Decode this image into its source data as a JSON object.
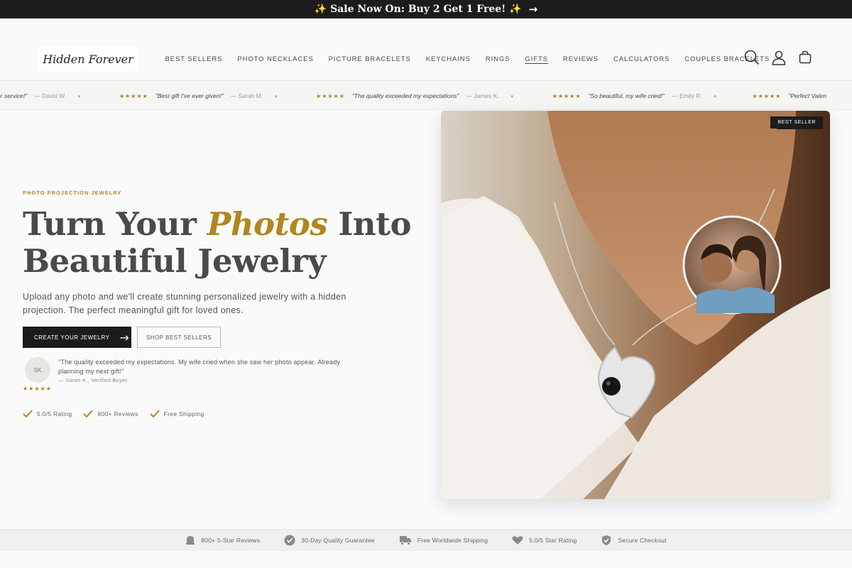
{
  "announcement": {
    "text": "✨ Sale Now On: Buy 2 Get 1 Free! ✨",
    "arrow": "→"
  },
  "logo": {
    "text": "Hidden Forever"
  },
  "nav": [
    {
      "label": "BEST SELLERS"
    },
    {
      "label": "PHOTO NECKLACES"
    },
    {
      "label": "PICTURE BRACELETS"
    },
    {
      "label": "KEYCHAINS"
    },
    {
      "label": "RINGS"
    },
    {
      "label": "GIFTS",
      "active": true
    },
    {
      "label": "REVIEWS"
    },
    {
      "label": "CALCULATORS"
    },
    {
      "label": "COUPLES BRACELETS"
    }
  ],
  "header_icons": [
    "search-icon",
    "account-icon",
    "cart-icon"
  ],
  "ticker": [
    {
      "stars": "",
      "quote": "er service!\"",
      "author": "— David W."
    },
    {
      "stars": "★★★★★",
      "quote": "\"Best gift I've ever given!\"",
      "author": "— Sarah M."
    },
    {
      "stars": "★★★★★",
      "quote": "\"The quality exceeded my expectations\"",
      "author": "— James K."
    },
    {
      "stars": "★★★★★",
      "quote": "\"So beautiful, my wife cried!\"",
      "author": "— Emily R."
    },
    {
      "stars": "★★★★★",
      "quote": "\"Perfect Valen",
      "author": ""
    }
  ],
  "hero": {
    "eyebrow": "PHOTO PROJECTION JEWELRY",
    "headline_part1": "Turn Your ",
    "headline_accent": "Photos",
    "headline_part2": " Into",
    "headline_line2": "Beautiful Jewelry",
    "subtext": "Upload any photo and we'll create stunning personalized jewelry with a hidden projection. The perfect meaningful gift for loved ones.",
    "primary_button": "CREATE YOUR JEWELRY",
    "primary_arrow": "→",
    "secondary_button": "SHOP BEST SELLERS",
    "best_seller_badge": "BEST SELLER"
  },
  "testimonial": {
    "initials": "SK",
    "quote": "\"The quality exceeded my expectations. My wife cried when she saw her photo appear. Already planning my next gift!\"",
    "author": "— Sarah K., Verified Buyer",
    "stars": "★★★★★"
  },
  "hero_badges": [
    {
      "label": "5.0/5 Rating"
    },
    {
      "label": "800+ Reviews"
    },
    {
      "label": "Free Shipping"
    }
  ],
  "trust_bar": [
    {
      "icon": "bell-icon",
      "label": "800+ 5-Star Reviews"
    },
    {
      "icon": "check-circle-icon",
      "label": "30-Day Quality Guarantee"
    },
    {
      "icon": "truck-icon",
      "label": "Free Worldwide Shipping"
    },
    {
      "icon": "heart-icon",
      "label": "5.0/5 Star Rating"
    },
    {
      "icon": "shield-check-icon",
      "label": "Secure Checkout"
    }
  ],
  "colors": {
    "accent": "#b0861e",
    "dark": "#1c1c1c",
    "text": "#4a4a4a"
  }
}
